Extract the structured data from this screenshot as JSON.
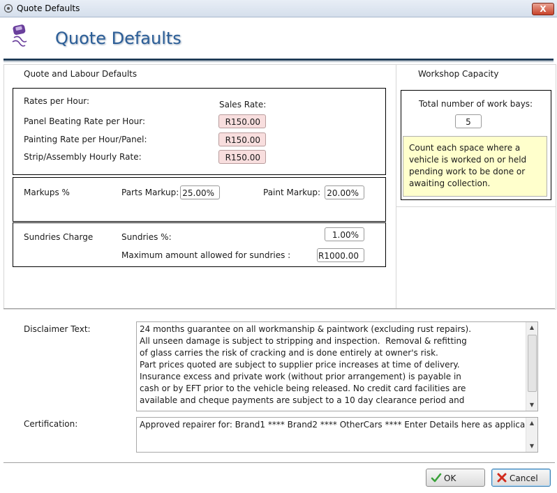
{
  "window": {
    "title": "Quote Defaults",
    "close_glyph": "X"
  },
  "header": {
    "title": "Quote Defaults",
    "logo_icon": "car-skid-icon"
  },
  "quote_labour": {
    "section_title": "Quote and Labour Defaults",
    "rates": {
      "heading": "Rates per Hour:",
      "sales_rate_label": "Sales Rate:",
      "rows": [
        {
          "label": "Panel Beating Rate per Hour:",
          "value": "R150.00"
        },
        {
          "label": "Painting Rate per Hour/Panel:",
          "value": "R150.00"
        },
        {
          "label": "Strip/Assembly Hourly Rate:",
          "value": "R150.00"
        }
      ]
    },
    "markups": {
      "heading": "Markups %",
      "parts_label": "Parts Markup:",
      "parts_value": "25.00%",
      "paint_label": "Paint Markup:",
      "paint_value": "20.00%"
    },
    "sundries": {
      "heading": "Sundries Charge",
      "percent_label": "Sundries %:",
      "percent_value": "1.00%",
      "max_label": "Maximum amount allowed for sundries :",
      "max_value": "R1000.00"
    }
  },
  "workshop": {
    "section_title": "Workshop Capacity",
    "bays_label": "Total number of work bays:",
    "bays_value": "5",
    "note": "Count each space where a vehicle is worked on or held pending work to be done or awaiting collection."
  },
  "disclaimer": {
    "label": "Disclaimer Text:",
    "text": "24 months guarantee on all workmanship & paintwork (excluding rust repairs).\nAll unseen damage is subject to stripping and inspection.  Removal & refitting\nof glass carries the risk of cracking and is done entirely at owner's risk.\nPart prices quoted are subject to supplier price increases at time of delivery.\nInsurance excess and private work (without prior arrangement) is payable in\ncash or by EFT prior to the vehicle being released. No credit card facilities are\navailable and cheque payments are subject to a 10 day clearance period and"
  },
  "certification": {
    "label": "Certification:",
    "text": "Approved repairer for:  Brand1 **** Brand2 **** OtherCars **** Enter Details here as applicable"
  },
  "buttons": {
    "ok_label": "OK",
    "cancel_label": "Cancel",
    "ok_icon": "checkmark-icon",
    "cancel_icon": "red-x-icon"
  },
  "colors": {
    "heading": "#2c5e97",
    "rate_field": "#f8dede",
    "note_bg": "#ffffcc"
  }
}
